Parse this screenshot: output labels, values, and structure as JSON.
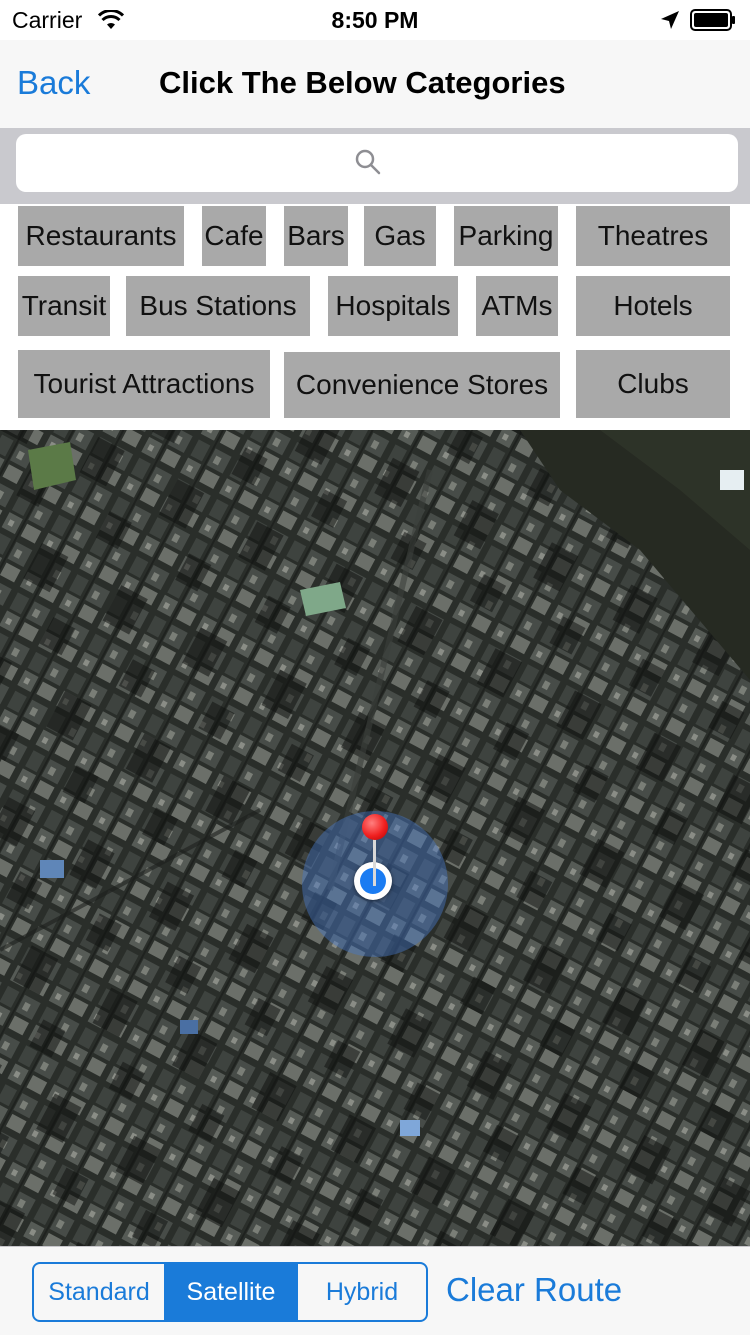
{
  "status_bar": {
    "carrier": "Carrier",
    "time": "8:50 PM"
  },
  "nav": {
    "back_label": "Back",
    "title": "Click The Below Categories"
  },
  "search": {
    "placeholder": ""
  },
  "categories": [
    {
      "label": "Restaurants"
    },
    {
      "label": "Cafe"
    },
    {
      "label": "Bars"
    },
    {
      "label": "Gas"
    },
    {
      "label": "Parking"
    },
    {
      "label": "Theatres"
    },
    {
      "label": "Transit"
    },
    {
      "label": "Bus Stations"
    },
    {
      "label": "Hospitals"
    },
    {
      "label": "ATMs"
    },
    {
      "label": "Hotels"
    },
    {
      "label": "Tourist Attractions"
    },
    {
      "label": "Convenience Stores"
    },
    {
      "label": "Clubs"
    }
  ],
  "map": {
    "mode": "satellite"
  },
  "toolbar": {
    "map_types": [
      "Standard",
      "Satellite",
      "Hybrid"
    ],
    "selected_map_type": "Satellite",
    "clear_route_label": "Clear Route"
  },
  "colors": {
    "accent": "#1a7bd9",
    "category_bg": "#a9a9a9",
    "pin": "#f02020",
    "user_location": "#1b7cf2"
  }
}
